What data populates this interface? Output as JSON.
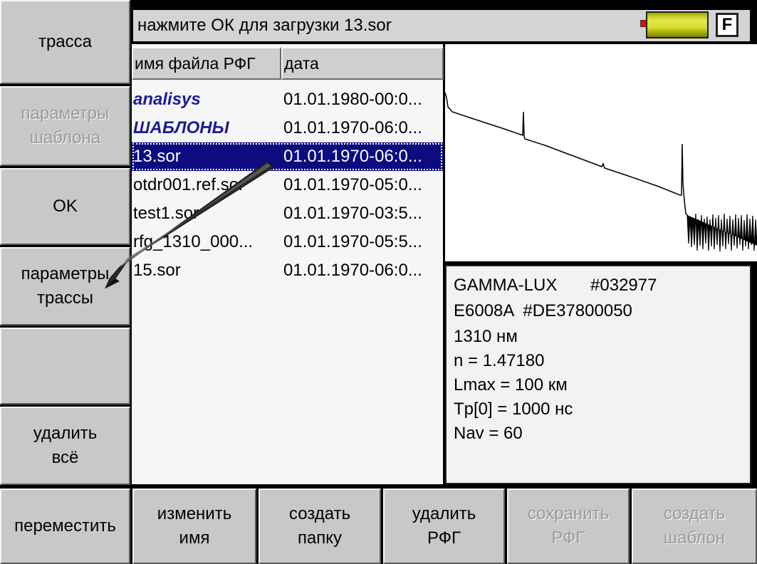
{
  "status": {
    "message": "нажмите ОК для загрузки 13.sor",
    "mode_badge": "F",
    "battery_level": 0.9
  },
  "left_buttons": [
    {
      "label": "трасса",
      "enabled": true
    },
    {
      "label": "параметры\nшаблона",
      "enabled": false
    },
    {
      "label": "OK",
      "enabled": true
    },
    {
      "label": "параметры\nтрассы",
      "enabled": true
    },
    {
      "label": "",
      "enabled": true
    },
    {
      "label": "удалить\nвсё",
      "enabled": true
    }
  ],
  "bottom_buttons": [
    {
      "label": "переместить",
      "enabled": true
    },
    {
      "label": "изменить\nимя",
      "enabled": true
    },
    {
      "label": "создать\nпапку",
      "enabled": true
    },
    {
      "label": "удалить\nРФГ",
      "enabled": true
    },
    {
      "label": "сохранить\nРФГ",
      "enabled": false
    },
    {
      "label": "создать\nшаблон",
      "enabled": false
    }
  ],
  "file_table": {
    "columns": [
      "имя файла РФГ",
      "дата"
    ],
    "rows": [
      {
        "name": "analisys",
        "date": "01.01.1980-00:0...",
        "type": "folder"
      },
      {
        "name": "ШАБЛОНЫ",
        "date": "01.01.1970-06:0...",
        "type": "folder"
      },
      {
        "name": "13.sor",
        "date": "01.01.1970-06:0...",
        "type": "file",
        "selected": true
      },
      {
        "name": "otdr001.ref.sor",
        "date": "01.01.1970-05:0...",
        "type": "file"
      },
      {
        "name": "test1.sor",
        "date": "01.01.1970-03:5...",
        "type": "file"
      },
      {
        "name": "rfg_1310_000...",
        "date": "01.01.1970-05:5...",
        "type": "file"
      },
      {
        "name": "15.sor",
        "date": "01.01.1970-06:0...",
        "type": "file"
      }
    ]
  },
  "info": {
    "lines": [
      "GAMMA-LUX       #032977",
      "E6008A  #DE37800050",
      "1310 нм",
      "n = 1.47180",
      "Lmax = 100 км",
      "Tp[0] = 1000 нс",
      "Nav = 60"
    ]
  },
  "colors": {
    "selection": "#0c0c80",
    "folder_text": "#1d1d93",
    "button_face": "#c8c8c8"
  }
}
